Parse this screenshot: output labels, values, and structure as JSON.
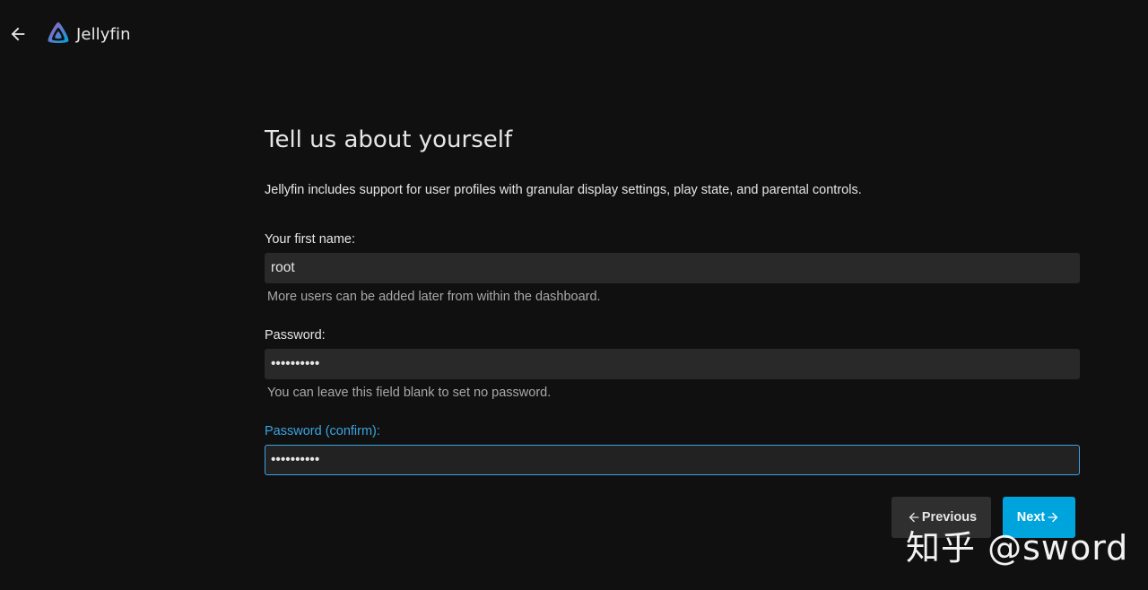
{
  "header": {
    "back_icon": "arrow-left-icon",
    "logo_icon": "jellyfin-logo-icon",
    "brand_name": "Jellyfin",
    "colors": {
      "logo_gradient_start": "#aa5cc3",
      "logo_gradient_end": "#00a4dc"
    }
  },
  "wizard": {
    "title": "Tell us about yourself",
    "intro": "Jellyfin includes support for user profiles with granular display settings, play state, and parental controls.",
    "fields": [
      {
        "label": "Your first name:",
        "value": "root",
        "help": "More users can be added later from within the dashboard."
      },
      {
        "label": "Password:",
        "value": "••••••••••",
        "help": "You can leave this field blank to set no password."
      },
      {
        "label": "Password (confirm):",
        "value": "••••••••••",
        "focused": true
      }
    ],
    "buttons": {
      "previous_label": "Previous",
      "previous_icon": "arrow-left-icon",
      "next_label": "Next",
      "next_icon": "arrow-right-icon"
    },
    "colors": {
      "accent": "#00a4dc",
      "focus": "#3ba4e0",
      "background": "#101010",
      "input_bg": "#292929"
    }
  },
  "watermark": {
    "text": "知乎 @sword"
  }
}
